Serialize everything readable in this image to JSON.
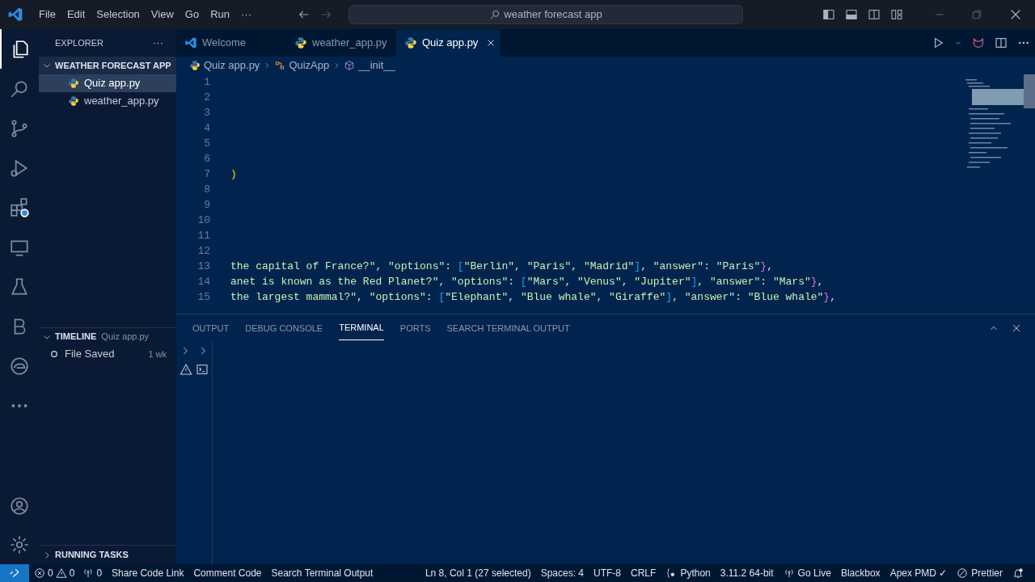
{
  "menu": [
    "File",
    "Edit",
    "Selection",
    "View",
    "Go",
    "Run",
    "···"
  ],
  "search": {
    "value": "weather forecast app"
  },
  "sidebar": {
    "title": "EXPLORER",
    "more": "···",
    "folder": {
      "label": "WEATHER FORECAST APP",
      "expanded": true
    },
    "files": [
      {
        "label": "Quiz app.py",
        "selected": true
      },
      {
        "label": "weather_app.py",
        "selected": false
      }
    ],
    "timeline": {
      "label": "TIMELINE",
      "file": "Quiz app.py",
      "expanded": true,
      "items": [
        {
          "label": "File Saved",
          "time": "1 wk"
        }
      ]
    },
    "running_tasks": {
      "label": "RUNNING TASKS",
      "expanded": false
    }
  },
  "tabs": [
    {
      "label": "Welcome",
      "kind": "vscode",
      "selected": false
    },
    {
      "label": "weather_app.py",
      "kind": "python",
      "selected": false
    },
    {
      "label": "Quiz app.py",
      "kind": "python",
      "selected": true
    }
  ],
  "breadcrumb": [
    {
      "label": "Quiz app.py",
      "kind": "python"
    },
    {
      "label": "QuizApp",
      "kind": "class"
    },
    {
      "label": "__init__",
      "kind": "method"
    }
  ],
  "code_lines": [
    {
      "number": "1"
    },
    {
      "number": "2"
    },
    {
      "number": "3"
    },
    {
      "number": "4"
    },
    {
      "number": "5"
    },
    {
      "number": "6"
    },
    {
      "number": "7",
      "tokens": [
        {
          "text": ")",
          "kind": "bracket1"
        }
      ]
    },
    {
      "number": "8"
    },
    {
      "number": "9"
    },
    {
      "number": "10"
    },
    {
      "number": "11"
    },
    {
      "number": "12"
    },
    {
      "number": "13",
      "tokens": [
        {
          "text": "the capital of France?\", \"options\": ",
          "kind": "string"
        },
        {
          "text": "[",
          "kind": "bracket3"
        },
        {
          "text": "\"Berlin\", \"Paris\", \"Madrid\"",
          "kind": "string"
        },
        {
          "text": "]",
          "kind": "bracket3"
        },
        {
          "text": ", \"answer\": \"Paris\"",
          "kind": "string"
        },
        {
          "text": "}",
          "kind": "bracket2"
        },
        {
          "text": ",",
          "kind": "string"
        }
      ]
    },
    {
      "number": "14",
      "tokens": [
        {
          "text": "anet is known as the Red Planet?\", \"options\": ",
          "kind": "string"
        },
        {
          "text": "[",
          "kind": "bracket3"
        },
        {
          "text": "\"Mars\", \"Venus\", \"Jupiter\"",
          "kind": "string"
        },
        {
          "text": "]",
          "kind": "bracket3"
        },
        {
          "text": ", \"answer\": \"Mars\"",
          "kind": "string"
        },
        {
          "text": "}",
          "kind": "bracket2"
        },
        {
          "text": ",",
          "kind": "string"
        }
      ]
    },
    {
      "number": "15",
      "tokens": [
        {
          "text": "the largest mammal?\", \"options\": ",
          "kind": "string"
        },
        {
          "text": "[",
          "kind": "bracket3"
        },
        {
          "text": "\"Elephant\", \"Blue whale\", \"Giraffe\"",
          "kind": "string"
        },
        {
          "text": "]",
          "kind": "bracket3"
        },
        {
          "text": ", \"answer\": \"Blue whale\"",
          "kind": "string"
        },
        {
          "text": "}",
          "kind": "bracket2"
        },
        {
          "text": ",",
          "kind": "string"
        }
      ]
    }
  ],
  "panel_tabs": [
    {
      "label": "OUTPUT",
      "selected": false
    },
    {
      "label": "DEBUG CONSOLE",
      "selected": false
    },
    {
      "label": "TERMINAL",
      "selected": true
    },
    {
      "label": "PORTS",
      "selected": false
    },
    {
      "label": "SEARCH TERMINAL OUTPUT",
      "selected": false
    }
  ],
  "status_bar": {
    "errors": "0",
    "warnings": "0",
    "ports": "0",
    "left": [
      "Share Code Link",
      "Comment Code",
      "Search Terminal Output"
    ],
    "right": [
      {
        "label": "Ln 8, Col 1 (27 selected)",
        "kind": "text"
      },
      {
        "label": "Spaces: 4",
        "kind": "text"
      },
      {
        "label": "UTF-8",
        "kind": "text"
      },
      {
        "label": "CRLF",
        "kind": "text"
      },
      {
        "label": "Python",
        "kind": "braces"
      },
      {
        "label": "3.11.2 64-bit",
        "kind": "text"
      },
      {
        "label": "Go Live",
        "kind": "broadcast"
      },
      {
        "label": "Blackbox",
        "kind": "text"
      },
      {
        "label": "Apex PMD ✓",
        "kind": "text"
      },
      {
        "label": "Prettier",
        "kind": "blocked"
      }
    ]
  }
}
